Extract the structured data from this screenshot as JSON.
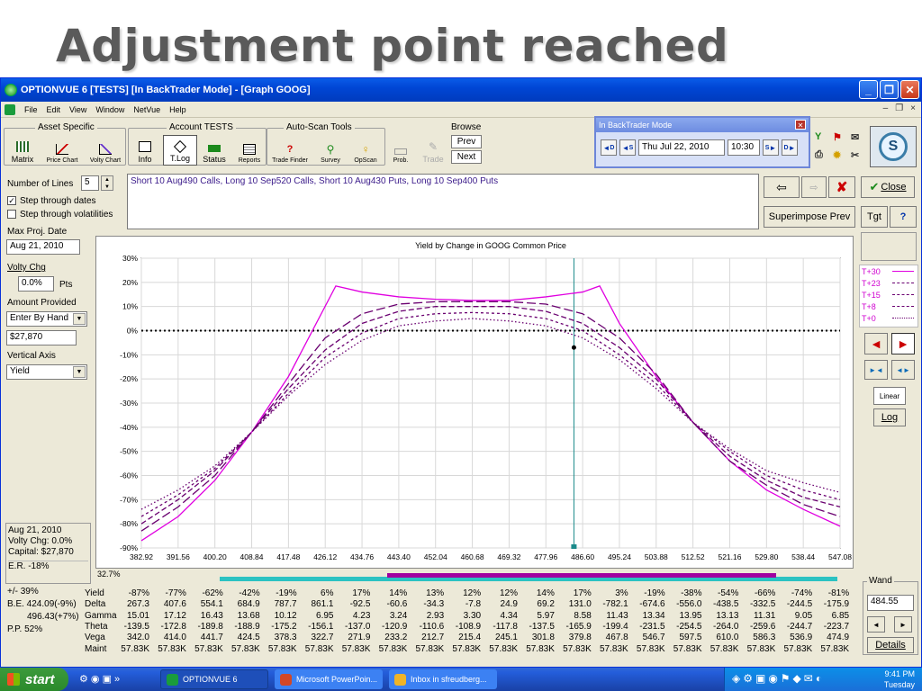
{
  "slide": {
    "title": "Adjustment point reached"
  },
  "window": {
    "title": "OPTIONVUE 6   [TESTS]   [In BackTrader Mode] - [Graph GOOG]"
  },
  "menu": [
    "File",
    "Edit",
    "View",
    "Window",
    "NetVue",
    "Help"
  ],
  "toolbar": {
    "groups": {
      "asset": "Asset Specific",
      "account": "Account TESTS",
      "autoscan": "Auto-Scan Tools",
      "browse": "Browse"
    },
    "buttons": {
      "matrix": "Matrix",
      "price_chart": "Price Chart",
      "volty_chart": "Volty Chart",
      "info": "Info",
      "tlog": "T.Log",
      "status": "Status",
      "reports": "Reports",
      "trade_finder": "Trade Finder",
      "survey": "Survey",
      "opscan": "OpScan",
      "prob": "Prob.",
      "trade": "Trade"
    },
    "browse": {
      "prev": "Prev",
      "next": "Next"
    }
  },
  "backtrader": {
    "title": "In BackTrader Mode",
    "md": "M",
    "ms": "M",
    "md_sub": "D",
    "ms_sub": "S",
    "date": "Thu Jul 22, 2010",
    "time": "10:30",
    "sm": "S",
    "dm": "D"
  },
  "left": {
    "num_lines_label": "Number of Lines",
    "num_lines": "5",
    "step_dates": "Step through dates",
    "step_vols": "Step through volatilities",
    "max_proj_label": "Max Proj. Date",
    "max_proj": "Aug 21, 2010",
    "volty_label": "Volty Chg",
    "volty_value": "0.0%",
    "volty_unit": "Pts",
    "amount_label": "Amount Provided",
    "amount_mode": "Enter By Hand",
    "amount_value": "$27,870",
    "vaxis_label": "Vertical Axis",
    "vaxis_value": "Yield"
  },
  "strategy": "Short 10 Aug490 Calls, Long 10 Sep520 Calls, Short 10 Aug430 Puts, Long 10 Sep400 Puts",
  "right_buttons": {
    "close": "Close",
    "superimpose": "Superimpose Prev",
    "tgt": "Tgt",
    "help": "?",
    "linear": "Linear",
    "log": "Log"
  },
  "legend": [
    {
      "label": "T+30",
      "style": "solid"
    },
    {
      "label": "T+23",
      "style": "long-dash"
    },
    {
      "label": "T+15",
      "style": "dash"
    },
    {
      "label": "T+8",
      "style": "short-dash"
    },
    {
      "label": "T+0",
      "style": "dot"
    }
  ],
  "stats": {
    "date": "Aug 21, 2010",
    "volty": "Volty Chg: 0.0%",
    "capital": "Capital: $27,870",
    "er": "E.R. -18%",
    "pct_marker": "32.7%",
    "pm": "+/-  39%",
    "be1": "B.E. 424.09(-9%)",
    "be2": "496.43(+7%)",
    "pp": "P.P. 52%"
  },
  "chart_data": {
    "type": "line",
    "title": "Yield by Change in GOOG Common Price",
    "x_ticks": [
      "382.92",
      "391.56",
      "400.20",
      "408.84",
      "417.48",
      "426.12",
      "434.76",
      "443.40",
      "452.04",
      "460.68",
      "469.32",
      "477.96",
      "486.60",
      "495.24",
      "503.88",
      "512.52",
      "521.16",
      "529.80",
      "538.44",
      "547.08"
    ],
    "y_ticks": [
      "30%",
      "20%",
      "10%",
      "0%",
      "-10%",
      "-20%",
      "-30%",
      "-40%",
      "-50%",
      "-60%",
      "-70%",
      "-80%",
      "-90%"
    ],
    "xlim": [
      382.92,
      547.08
    ],
    "ylim": [
      -90,
      30
    ],
    "current_price": 484.55,
    "current_yield": -7,
    "series": [
      {
        "name": "T+30",
        "color": "#e000e0",
        "x": [
          382.92,
          391.56,
          400.2,
          408.84,
          417.48,
          428.6,
          434.76,
          443.4,
          452.04,
          460.68,
          469.32,
          477.96,
          486.6,
          490.6,
          495.24,
          503.88,
          512.52,
          521.16,
          529.8,
          538.44,
          547.08
        ],
        "y": [
          -87,
          -77,
          -62,
          -42,
          -19,
          18.5,
          16,
          14,
          13,
          12.5,
          12.5,
          14,
          16,
          18.5,
          3,
          -19,
          -38,
          -54,
          -66,
          -74,
          -81
        ]
      },
      {
        "name": "T+23",
        "color": "#6a0070",
        "x": [
          382.92,
          391.56,
          400.2,
          408.84,
          417.48,
          426.12,
          434.76,
          443.4,
          452.04,
          460.68,
          469.32,
          477.96,
          486.6,
          495.24,
          503.88,
          512.52,
          521.16,
          529.8,
          538.44,
          547.08
        ],
        "y": [
          -83,
          -73,
          -60,
          -42,
          -22,
          -3,
          7,
          11,
          12,
          12,
          12,
          11,
          7,
          -3,
          -18,
          -38,
          -54,
          -64,
          -72,
          -77
        ]
      },
      {
        "name": "T+15",
        "color": "#6a0070",
        "x": [
          382.92,
          391.56,
          400.2,
          408.84,
          417.48,
          426.12,
          434.76,
          443.4,
          452.04,
          460.68,
          469.32,
          477.96,
          486.6,
          495.24,
          503.88,
          512.52,
          521.16,
          529.8,
          538.44,
          547.08
        ],
        "y": [
          -80,
          -70,
          -58,
          -42,
          -24,
          -8,
          3,
          8,
          10,
          10,
          10,
          8,
          3,
          -7,
          -20,
          -38,
          -52,
          -62,
          -69,
          -73
        ]
      },
      {
        "name": "T+8",
        "color": "#6a0070",
        "x": [
          382.92,
          391.56,
          400.2,
          408.84,
          417.48,
          426.12,
          434.76,
          443.4,
          452.04,
          460.68,
          469.32,
          477.96,
          486.6,
          495.24,
          503.88,
          512.52,
          521.16,
          529.8,
          538.44,
          547.08
        ],
        "y": [
          -77,
          -68,
          -57,
          -42,
          -26,
          -11,
          -1,
          5,
          7,
          7.5,
          7,
          5,
          0,
          -10,
          -22,
          -38,
          -50,
          -60,
          -66,
          -70
        ]
      },
      {
        "name": "T+0",
        "color": "#6a0070",
        "x": [
          382.92,
          391.56,
          400.2,
          408.84,
          417.48,
          426.12,
          434.76,
          443.4,
          452.04,
          460.68,
          469.32,
          477.96,
          486.6,
          495.24,
          503.88,
          512.52,
          521.16,
          529.8,
          538.44,
          547.08
        ],
        "y": [
          -74,
          -66,
          -56,
          -42,
          -27,
          -14,
          -4,
          2,
          4,
          5,
          4,
          2,
          -3,
          -12,
          -24,
          -38,
          -49,
          -58,
          -63,
          -67
        ]
      }
    ]
  },
  "table": {
    "rows": [
      {
        "label": "Yield",
        "values": [
          "-87%",
          "-77%",
          "-62%",
          "-42%",
          "-19%",
          "6%",
          "17%",
          "14%",
          "13%",
          "12%",
          "12%",
          "14%",
          "17%",
          "3%",
          "-19%",
          "-38%",
          "-54%",
          "-66%",
          "-74%",
          "-81%"
        ]
      },
      {
        "label": "Delta",
        "values": [
          "267.3",
          "407.6",
          "554.1",
          "684.9",
          "787.7",
          "861.1",
          "-92.5",
          "-60.6",
          "-34.3",
          "-7.8",
          "24.9",
          "69.2",
          "131.0",
          "-782.1",
          "-674.6",
          "-556.0",
          "-438.5",
          "-332.5",
          "-244.5",
          "-175.9"
        ]
      },
      {
        "label": "Gamma",
        "values": [
          "15.01",
          "17.12",
          "16.43",
          "13.68",
          "10.12",
          "6.95",
          "4.23",
          "3.24",
          "2.93",
          "3.30",
          "4.34",
          "5.97",
          "8.58",
          "11.43",
          "13.34",
          "13.95",
          "13.13",
          "11.31",
          "9.05",
          "6.85"
        ]
      },
      {
        "label": "Theta",
        "values": [
          "-139.5",
          "-172.8",
          "-189.8",
          "-188.9",
          "-175.2",
          "-156.1",
          "-137.0",
          "-120.9",
          "-110.6",
          "-108.9",
          "-117.8",
          "-137.5",
          "-165.9",
          "-199.4",
          "-231.5",
          "-254.5",
          "-264.0",
          "-259.6",
          "-244.7",
          "-223.7"
        ]
      },
      {
        "label": "Vega",
        "values": [
          "342.0",
          "414.0",
          "441.7",
          "424.5",
          "378.3",
          "322.7",
          "271.9",
          "233.2",
          "212.7",
          "215.4",
          "245.1",
          "301.8",
          "379.8",
          "467.8",
          "546.7",
          "597.5",
          "610.0",
          "586.3",
          "536.9",
          "474.9"
        ]
      },
      {
        "label": "Maint",
        "values": [
          "57.83K",
          "57.83K",
          "57.83K",
          "57.83K",
          "57.83K",
          "57.83K",
          "57.83K",
          "57.83K",
          "57.83K",
          "57.83K",
          "57.83K",
          "57.83K",
          "57.83K",
          "57.83K",
          "57.83K",
          "57.83K",
          "57.83K",
          "57.83K",
          "57.83K",
          "57.83K"
        ]
      }
    ]
  },
  "wand": {
    "label": "Wand",
    "value": "484.55",
    "details": "Details"
  },
  "taskbar": {
    "start": "start",
    "tasks": [
      "OPTIONVUE 6",
      "Microsoft PowerPoin...",
      "Inbox in sfreudberg..."
    ],
    "time": "9:41 PM",
    "day": "Tuesday"
  }
}
